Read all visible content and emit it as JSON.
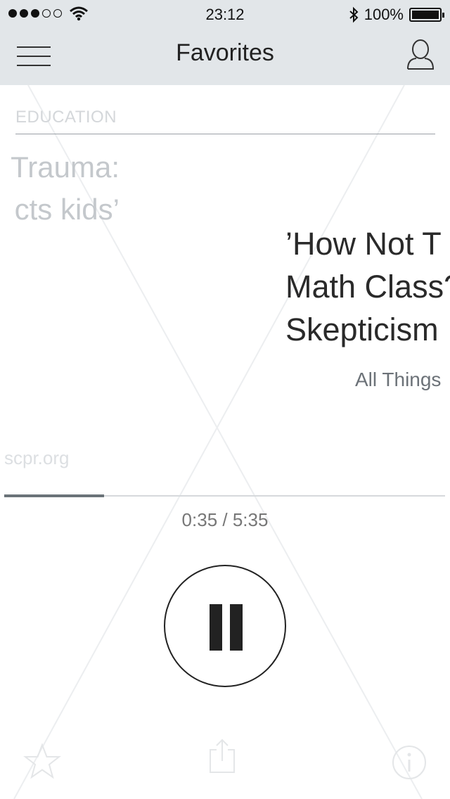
{
  "status_bar": {
    "time": "23:12",
    "battery_text": "100%",
    "battery_level": 1.0,
    "signal_bars_filled": 3,
    "signal_bars_total": 5,
    "icons": [
      "signal-dots-icon",
      "wifi-icon",
      "bluetooth-icon",
      "battery-icon"
    ]
  },
  "nav": {
    "title": "Favorites",
    "left_icon": "hamburger-menu-icon",
    "right_icon": "user-profile-icon"
  },
  "category": {
    "label": "EDUCATION"
  },
  "previous_story": {
    "title_line1": "Trauma:",
    "title_line2": "cts kids’",
    "source": "scpr.org"
  },
  "current_story": {
    "title_line1": "’How Not T",
    "title_line2": "Math Class?",
    "title_line3": "Skepticism",
    "source": "All Things"
  },
  "player": {
    "elapsed": "0:35",
    "separator": " / ",
    "duration": "5:35",
    "progress": 0.227,
    "state_icon": "pause-icon"
  },
  "toolbar": {
    "items": [
      "star-icon",
      "share-icon",
      "info-icon"
    ]
  },
  "colors": {
    "nav_background": "#e2e6e9",
    "text_dark": "#2a2a2a",
    "text_muted": "#6c7278",
    "progress_fill": "#6b7379"
  }
}
